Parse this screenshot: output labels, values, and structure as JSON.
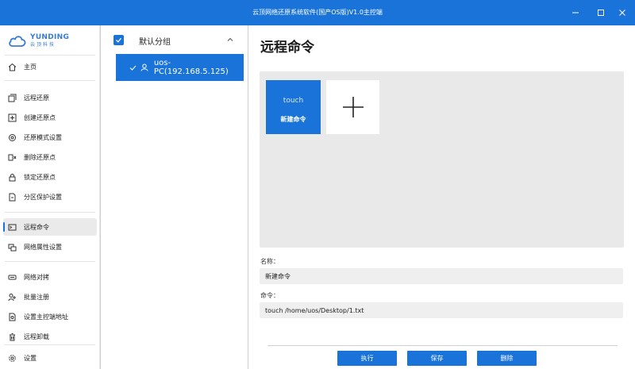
{
  "window": {
    "title": "云顶网络还原系统软件(国产OS版)V1.0主控端",
    "controls": [
      "minimize",
      "maximize",
      "close"
    ]
  },
  "logo": {
    "main": "YUNDING",
    "sub": "云顶科技"
  },
  "sidebar": {
    "items": [
      {
        "label": "主页",
        "icon": "home-icon"
      },
      {
        "label": "远程还原",
        "icon": "restore-icon"
      },
      {
        "label": "创建还原点",
        "icon": "create-point-icon"
      },
      {
        "label": "还原模式设置",
        "icon": "mode-settings-icon"
      },
      {
        "label": "删除还原点",
        "icon": "delete-point-icon"
      },
      {
        "label": "锁定还原点",
        "icon": "lock-icon"
      },
      {
        "label": "分区保护设置",
        "icon": "partition-icon"
      },
      {
        "label": "远程命令",
        "icon": "terminal-icon",
        "active": true
      },
      {
        "label": "网络属性设置",
        "icon": "network-settings-icon"
      },
      {
        "label": "网络对拷",
        "icon": "network-copy-icon"
      },
      {
        "label": "批量注册",
        "icon": "batch-register-icon"
      },
      {
        "label": "设置主控端地址",
        "icon": "master-address-icon"
      },
      {
        "label": "远程卸载",
        "icon": "uninstall-icon"
      },
      {
        "label": "设置",
        "icon": "gear-icon"
      }
    ]
  },
  "tree": {
    "group_label": "默认分组",
    "group_checked": true,
    "group_expanded": true,
    "pc_name": "uos-PC(192.168.5.125)"
  },
  "main": {
    "title": "远程命令",
    "command_card": {
      "preview": "touch",
      "name": "新建命令"
    },
    "name_label": "名称：",
    "name_value": "新建命令",
    "command_label": "命令：",
    "command_value": "touch /home/uos/Desktop/1.txt",
    "buttons": {
      "execute": "执行",
      "save": "保存",
      "delete": "删除"
    }
  },
  "colors": {
    "accent": "#1a73d8",
    "panel": "#e9e9e9",
    "field": "#efefef"
  }
}
